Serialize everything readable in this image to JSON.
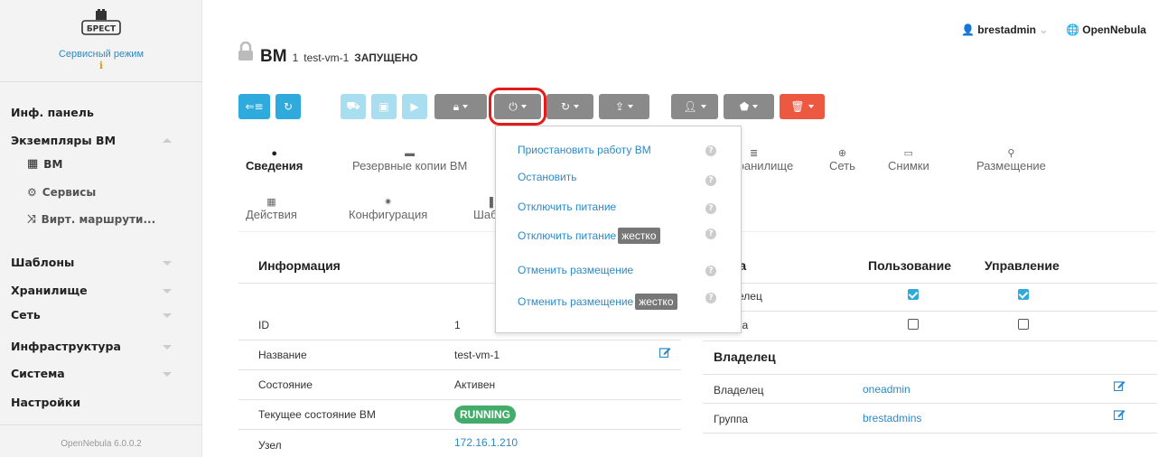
{
  "sidebar": {
    "mode": "Сервисный режим",
    "items": {
      "dashboard": "Инф. панель",
      "vm_instances": "Экземпляры ВМ",
      "vm": "ВМ",
      "services": "Сервисы",
      "vrouters": "Вирт. маршрути...",
      "templates": "Шаблоны",
      "storage": "Хранилище",
      "network": "Сеть",
      "infra": "Инфраструктура",
      "system": "Система",
      "settings": "Настройки"
    },
    "version": "OpenNebula 6.0.0.2"
  },
  "header": {
    "title": "ВМ",
    "vm_id": "1",
    "vm_name": "test-vm-1",
    "vm_state": "ЗАПУЩЕНО",
    "user": "brestadmin",
    "zone": "OpenNebula"
  },
  "tabs": {
    "info": "Сведения",
    "backups": "Резервные копии ВМ",
    "storage": "Хранилище",
    "network": "Сеть",
    "snapshots": "Снимки",
    "placement": "Размещение",
    "actions": "Действия",
    "conf": "Конфигурация",
    "templ": "Шаблон"
  },
  "power_menu": {
    "suspend": "Приостановить работу ВМ",
    "stop": "Остановить",
    "poweroff": "Отключить питание",
    "poweroff_hard": "Отключить питание",
    "undeploy": "Отменить размещение",
    "undeploy_hard": "Отменить размещение",
    "hard_tag": "жестко"
  },
  "info": {
    "heading": "Информация",
    "rows": {
      "id_label": "ID",
      "id_value": "1",
      "name_label": "Название",
      "name_value": "test-vm-1",
      "state_label": "Состояние",
      "state_value": "Активен",
      "lcm_label": "Текущее состояние ВМ",
      "lcm_value": "RUNNING",
      "host_label": "Узел",
      "host_value": "172.16.1.210"
    }
  },
  "permissions": {
    "col_rights": "ва",
    "col_use": "Пользование",
    "col_manage": "Управление",
    "row_owner": "делец",
    "row_group": "па"
  },
  "ownership": {
    "heading": "Владелец",
    "owner_label": "Владелец",
    "owner_value": "oneadmin",
    "group_label": "Группа",
    "group_value": "brestadmins"
  },
  "colors": {
    "accent": "#2eaadc",
    "danger": "#ec5840",
    "success": "#43ac6a",
    "highlight": "#e41b1b"
  }
}
